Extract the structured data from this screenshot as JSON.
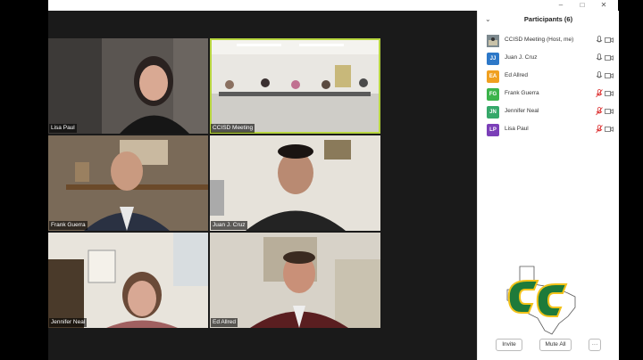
{
  "window": {
    "minimize_icon": "minimize-icon",
    "restore_icon": "restore-icon",
    "close_icon": "close-icon"
  },
  "tiles": [
    {
      "name": "Lisa Paul",
      "active": false
    },
    {
      "name": "CCISD Meeting",
      "active": true
    },
    {
      "name": "Frank Guerra",
      "active": false
    },
    {
      "name": "Juan J. Cruz",
      "active": false
    },
    {
      "name": "Jennifer Neal",
      "active": false
    },
    {
      "name": "Ed Allred",
      "active": false
    }
  ],
  "participants_panel": {
    "title": "Participants (6)",
    "participants": [
      {
        "initials": "",
        "name": "CCISD Meeting (Host, me)",
        "color": "#5a6b7a",
        "muted": false
      },
      {
        "initials": "JJ",
        "name": "Juan J. Cruz",
        "color": "#2d78c8",
        "muted": false
      },
      {
        "initials": "EA",
        "name": "Ed Allred",
        "color": "#f0a020",
        "muted": false
      },
      {
        "initials": "FG",
        "name": "Frank Guerra",
        "color": "#3cb44b",
        "muted": true
      },
      {
        "initials": "JN",
        "name": "Jennifer Neal",
        "color": "#36a86a",
        "muted": true
      },
      {
        "initials": "LP",
        "name": "Lisa Paul",
        "color": "#7b3fb8",
        "muted": true
      }
    ],
    "invite_label": "Invite",
    "mute_all_label": "Mute All",
    "more_label": "···"
  },
  "colors": {
    "active_speaker": "#b8d640",
    "logo_green": "#1e7a3a",
    "logo_gold": "#f2c21a"
  }
}
